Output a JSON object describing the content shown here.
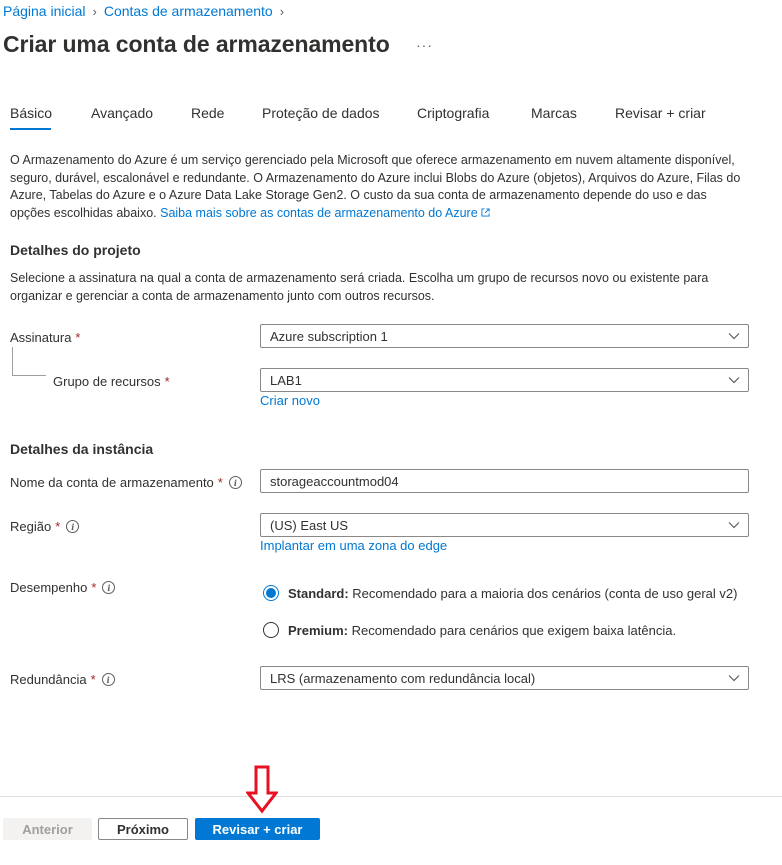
{
  "breadcrumb": {
    "items": [
      {
        "label": "Página inicial"
      },
      {
        "label": "Contas de armazenamento"
      }
    ]
  },
  "page": {
    "title": "Criar uma conta de armazenamento",
    "more": "···"
  },
  "tabs": [
    {
      "label": "Básico",
      "active": true
    },
    {
      "label": "Avançado"
    },
    {
      "label": "Rede"
    },
    {
      "label": "Proteção de dados"
    },
    {
      "label": "Criptografia"
    },
    {
      "label": "Marcas"
    },
    {
      "label": "Revisar + criar"
    }
  ],
  "intro": {
    "text": "O Armazenamento do Azure é um serviço gerenciado pela Microsoft que oferece armazenamento em nuvem altamente disponível, seguro, durável, escalonável e redundante. O Armazenamento do Azure inclui Blobs do Azure (objetos), Arquivos do Azure, Filas do Azure, Tabelas do Azure e o Azure Data Lake Storage Gen2. O custo da sua conta de armazenamento depende do uso e das opções escolhidas abaixo.",
    "link": "Saiba mais sobre as contas de armazenamento do Azure"
  },
  "project": {
    "title": "Detalhes do projeto",
    "description": "Selecione a assinatura na qual a conta de armazenamento será criada. Escolha um grupo de recursos novo ou existente para organizar e gerenciar a conta de armazenamento junto com outros recursos.",
    "subscription": {
      "label": "Assinatura",
      "required": "*",
      "value": "Azure subscription 1"
    },
    "resource_group": {
      "label": "Grupo de recursos",
      "required": "*",
      "value": "LAB1",
      "create_link": "Criar novo"
    }
  },
  "instance": {
    "title": "Detalhes da instância",
    "account_name": {
      "label": "Nome da conta de armazenamento",
      "required": "*",
      "value": "storageaccountmod04"
    },
    "region": {
      "label": "Região",
      "required": "*",
      "value": "(US) East US",
      "edge_link": "Implantar em uma zona do edge"
    },
    "performance": {
      "label": "Desempenho",
      "required": "*",
      "options": [
        {
          "name": "Standard:",
          "desc": "Recomendado para a maioria dos cenários (conta de uso geral v2)",
          "selected": true
        },
        {
          "name": "Premium:",
          "desc": "Recomendado para cenários que exigem baixa latência.",
          "selected": false
        }
      ]
    },
    "redundancy": {
      "label": "Redundância",
      "required": "*",
      "value": "LRS (armazenamento com redundância local)"
    }
  },
  "footer": {
    "previous": "Anterior",
    "next": "Próximo",
    "review": "Revisar + criar"
  },
  "colors": {
    "accent": "#0078d4",
    "annotation_arrow": "#e81123",
    "required": "#a4262c"
  },
  "icons": [
    "chevron-right-icon",
    "ellipsis-icon",
    "external-link-icon",
    "info-icon",
    "chevron-down-icon",
    "red-down-arrow-icon"
  ]
}
